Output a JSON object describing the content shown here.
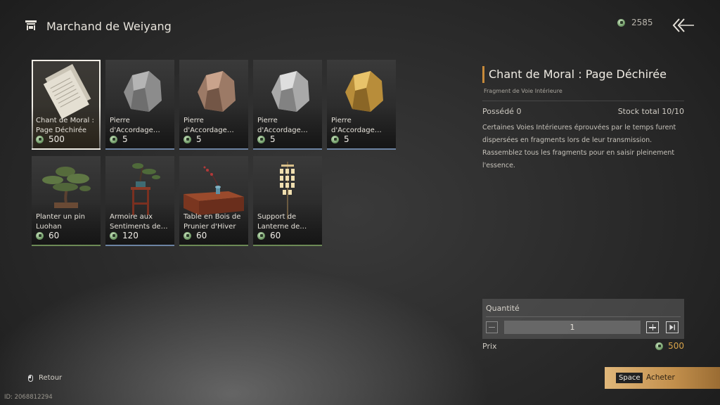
{
  "header": {
    "title": "Marchand de Weiyang",
    "icon": "shop-icon"
  },
  "currency": {
    "amount": "2585",
    "icon": "jade-coin-icon"
  },
  "back_icon": "back-arrow-icon",
  "items": [
    {
      "name": "Chant de Moral : Page Déchirée",
      "line1": "Chant de Moral :",
      "line2": "Page Déchirée",
      "price": "500",
      "rarity": "gold",
      "art": "scroll-pages-icon",
      "selected": true
    },
    {
      "name": "Pierre d'Accordage…",
      "line1": "Pierre",
      "line2": "d'Accordage…",
      "price": "5",
      "rarity": "blue",
      "art": "gray-stone-icon"
    },
    {
      "name": "Pierre d'Accordage…",
      "line1": "Pierre",
      "line2": "d'Accordage…",
      "price": "5",
      "rarity": "blue",
      "art": "bronze-stone-icon"
    },
    {
      "name": "Pierre d'Accordage…",
      "line1": "Pierre",
      "line2": "d'Accordage…",
      "price": "5",
      "rarity": "blue",
      "art": "silver-stone-icon"
    },
    {
      "name": "Pierre d'Accordage…",
      "line1": "Pierre",
      "line2": "d'Accordage…",
      "price": "5",
      "rarity": "blue",
      "art": "gold-stone-icon"
    },
    {
      "name": "Planter un pin Luohan",
      "line1": "Planter un pin",
      "line2": "Luohan",
      "price": "60",
      "rarity": "green",
      "art": "bonsai-pine-icon"
    },
    {
      "name": "Armoire aux Sentiments de…",
      "line1": "Armoire aux",
      "line2": "Sentiments de…",
      "price": "120",
      "rarity": "blue",
      "art": "bonsai-stand-icon"
    },
    {
      "name": "Table en Bois de Prunier d'Hiver",
      "line1": "Table en Bois de",
      "line2": "Prunier d'Hiver",
      "price": "60",
      "rarity": "green",
      "art": "wooden-table-icon"
    },
    {
      "name": "Support de Lanterne de…",
      "line1": "Support de",
      "line2": "Lanterne de…",
      "price": "60",
      "rarity": "green",
      "art": "lantern-stand-icon"
    }
  ],
  "detail": {
    "title": "Chant de Moral : Page Déchirée",
    "subtitle": "Fragment de Voie Intérieure",
    "owned": "Possédé 0",
    "stock": "Stock total 10/10",
    "description": "Certaines Voies Intérieures éprouvées par le temps furent dispersées en fragments lors de leur transmission. Rassemblez tous les fragments pour en saisir pleinement l'essence."
  },
  "quantity": {
    "label": "Quantité",
    "value": "1"
  },
  "price": {
    "label": "Prix",
    "value": "500"
  },
  "buy": {
    "key": "Space",
    "label": "Acheter"
  },
  "back": {
    "label": "Retour"
  },
  "player_id": "ID: 2068812294",
  "colors": {
    "accent_gold": "#d9a44a",
    "buy_button": "#c28f4c",
    "rarity_blue": "#6d84a3",
    "rarity_green": "#6d8a56"
  }
}
